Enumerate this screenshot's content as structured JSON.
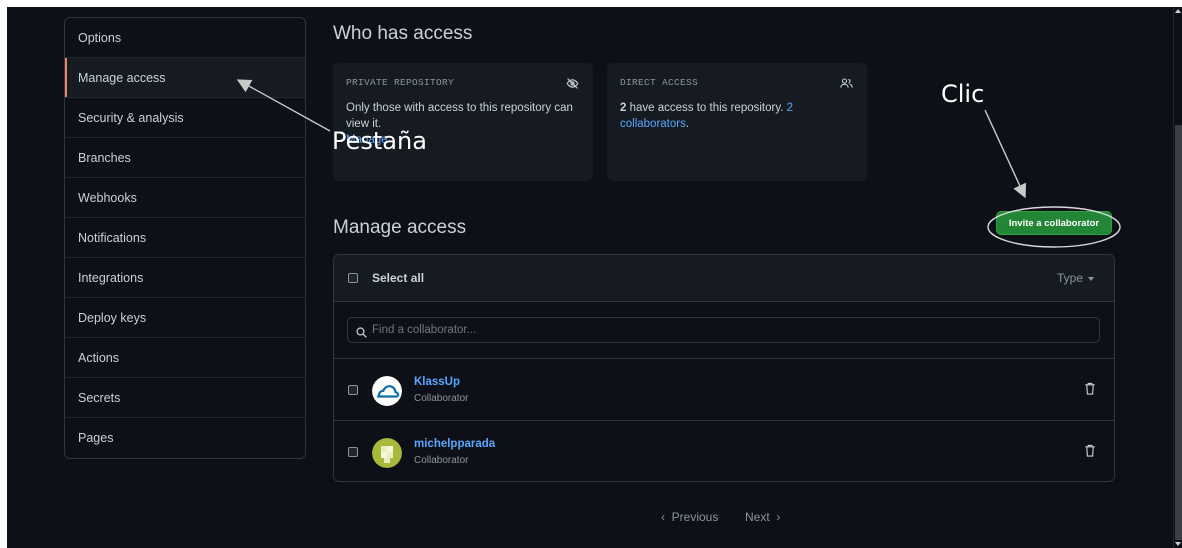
{
  "sidebar": {
    "items": [
      {
        "label": "Options"
      },
      {
        "label": "Manage access"
      },
      {
        "label": "Security & analysis"
      },
      {
        "label": "Branches"
      },
      {
        "label": "Webhooks"
      },
      {
        "label": "Notifications"
      },
      {
        "label": "Integrations"
      },
      {
        "label": "Deploy keys"
      },
      {
        "label": "Actions"
      },
      {
        "label": "Secrets"
      },
      {
        "label": "Pages"
      }
    ],
    "selected": "Manage access"
  },
  "who_has_access": {
    "title": "Who has access",
    "private_card": {
      "label": "PRIVATE REPOSITORY",
      "text": "Only those with access to this repository can view it.",
      "link": "Manage",
      "icon": "eye-closed-icon"
    },
    "direct_card": {
      "label": "DIRECT ACCESS",
      "count": "2",
      "text": " have access to this repository. ",
      "link": "2 collaborators",
      "suffix": ".",
      "icon": "people-icon"
    }
  },
  "manage_access": {
    "title": "Manage access",
    "invite_button": "Invite a collaborator",
    "select_all": "Select all",
    "type_filter": "Type",
    "search_placeholder": "Find a collaborator...",
    "collaborators": [
      {
        "name": "KlassUp",
        "role": "Collaborator"
      },
      {
        "name": "michelpparada",
        "role": "Collaborator"
      }
    ]
  },
  "pagination": {
    "previous": "Previous",
    "next": "Next"
  },
  "annotations": {
    "tab_label": "Pestaña",
    "click_label": "Clic"
  },
  "colors": {
    "background": "#0d1117",
    "accent_green": "#238636",
    "link_blue": "#58a6ff",
    "selected_marker": "#f78166"
  }
}
